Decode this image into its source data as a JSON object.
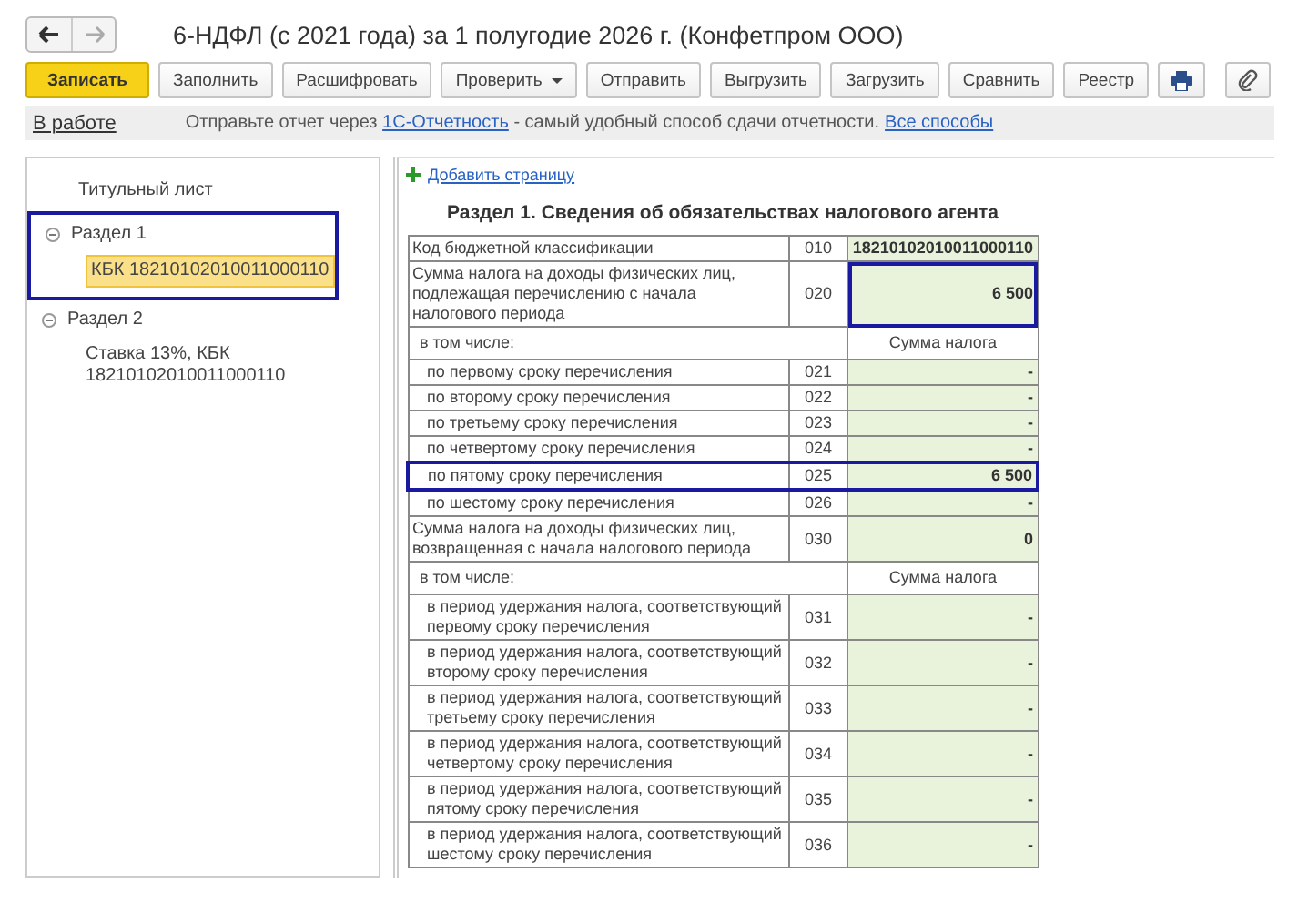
{
  "window": {
    "title": "6-НДФЛ (с 2021 года) за 1 полугодие 2026 г. (Конфетпром ООО)"
  },
  "toolbar": [
    {
      "kind": "primary",
      "label": "Записать"
    },
    {
      "kind": "normal",
      "label": "Заполнить"
    },
    {
      "kind": "normal",
      "label": "Расшифровать"
    },
    {
      "kind": "dropdown",
      "label": "Проверить"
    },
    {
      "kind": "normal",
      "label": "Отправить"
    },
    {
      "kind": "normal",
      "label": "Выгрузить"
    },
    {
      "kind": "normal",
      "label": "Загрузить"
    },
    {
      "kind": "normal",
      "label": "Сравнить"
    },
    {
      "kind": "normal",
      "label": "Реестр"
    },
    {
      "kind": "print"
    },
    {
      "kind": "attach"
    }
  ],
  "info_bar": {
    "state": "В работе",
    "before": "Отправьте отчет через ",
    "link": "1С-Отчетность",
    "after": " - самый удобный способ сдачи отчетности.",
    "all_link": "Все способы"
  },
  "tree": [
    {
      "label": "Титульный лист",
      "highlighted": false
    },
    {
      "label": "Раздел 1",
      "expanded": true,
      "highlighted": true,
      "children": [
        {
          "label": "КБК 18210102010011000110",
          "selected": true
        }
      ]
    },
    {
      "label": "Раздел 2",
      "expanded": true,
      "highlighted": false,
      "children": [
        {
          "label": "Ставка 13%, КБК 18210102010011000110",
          "selected": false
        }
      ]
    }
  ],
  "form": {
    "add_page": "Добавить страницу",
    "section_title": "Раздел 1. Сведения об обязательствах налогового агента",
    "rows": [
      {
        "kind": "line",
        "label": "Код бюджетной классификации",
        "code": "010",
        "value": "18210102010011000110"
      },
      {
        "kind": "line",
        "label": "Сумма налога на доходы физических лиц, подлежащая перечислению с начала налогового периода",
        "code": "020",
        "value": "6 500",
        "value_framed": true
      },
      {
        "kind": "subheader",
        "label": "в том числе:",
        "value_header": "Сумма налога"
      },
      {
        "kind": "sub",
        "label": "по первому сроку перечисления",
        "code": "021",
        "value": "-"
      },
      {
        "kind": "sub",
        "label": "по второму сроку перечисления",
        "code": "022",
        "value": "-"
      },
      {
        "kind": "sub",
        "label": "по третьему сроку перечисления",
        "code": "023",
        "value": "-"
      },
      {
        "kind": "sub",
        "label": "по четвертому сроку перечисления",
        "code": "024",
        "value": "-"
      },
      {
        "kind": "sub",
        "label": "по пятому сроку перечисления",
        "code": "025",
        "value": "6 500",
        "row_framed": true
      },
      {
        "kind": "sub",
        "label": "по шестому сроку перечисления",
        "code": "026",
        "value": "-"
      },
      {
        "kind": "line",
        "label": "Сумма налога на доходы физических лиц, возвращенная с начала налогового периода",
        "code": "030",
        "value": "0"
      },
      {
        "kind": "subheader",
        "label": "в том числе:",
        "value_header": "Сумма налога"
      },
      {
        "kind": "sub",
        "label": "в период удержания налога, соответствующий первому сроку перечисления",
        "code": "031",
        "value": "-"
      },
      {
        "kind": "sub",
        "label": "в период удержания налога, соответствующий второму сроку перечисления",
        "code": "032",
        "value": "-"
      },
      {
        "kind": "sub",
        "label": "в период удержания налога, соответствующий третьему сроку перечисления",
        "code": "033",
        "value": "-"
      },
      {
        "kind": "sub",
        "label": "в период удержания налога, соответствующий четвертому сроку перечисления",
        "code": "034",
        "value": "-"
      },
      {
        "kind": "sub",
        "label": "в период удержания налога, соответствующий пятому сроку перечисления",
        "code": "035",
        "value": "-"
      },
      {
        "kind": "sub",
        "label": "в период удержания налога, соответствующий шестому сроку перечисления",
        "code": "036",
        "value": "-"
      }
    ]
  }
}
